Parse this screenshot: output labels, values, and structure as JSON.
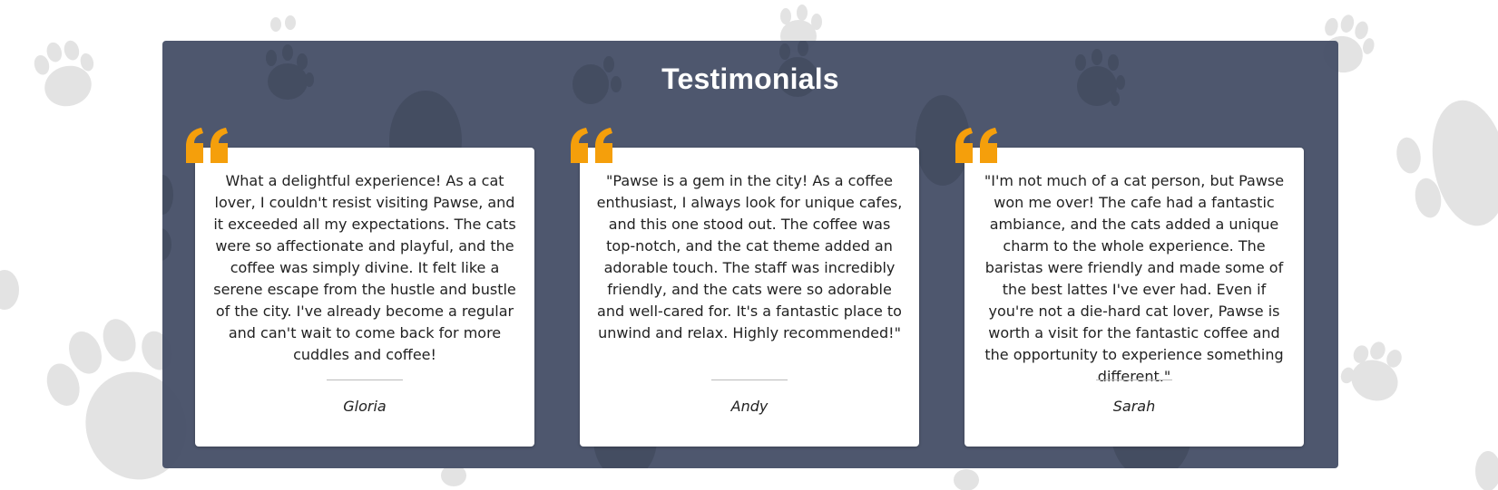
{
  "section": {
    "title": "Testimonials",
    "accent_color": "#f59f0b",
    "panel_color": "#444e66"
  },
  "testimonials": [
    {
      "text": "What a delightful experience! As a cat lover, I couldn't resist visiting Pawse, and it exceeded all my expectations. The cats were so affectionate and playful, and the coffee was simply divine. It felt like a serene escape from the hustle and bustle of the city. I've already become a regular and can't wait to come back for more cuddles and coffee!",
      "author": "Gloria",
      "icon": "quote-icon"
    },
    {
      "text": "\"Pawse is a gem in the city! As a coffee enthusiast, I always look for unique cafes, and this one stood out. The coffee was top-notch, and the cat theme added an adorable touch. The staff was incredibly friendly, and the cats were so adorable and well-cared for. It's a fantastic place to unwind and relax. Highly recommended!\"",
      "author": "Andy",
      "icon": "quote-icon"
    },
    {
      "text": "\"I'm not much of a cat person, but Pawse won me over! The cafe had a fantastic ambiance, and the cats added a unique charm to the whole experience. The baristas were friendly and made some of the best lattes I've ever had. Even if you're not a die-hard cat lover, Pawse is worth a visit for the fantastic coffee and the opportunity to experience something different.\"",
      "author": "Sarah",
      "icon": "quote-icon"
    }
  ]
}
